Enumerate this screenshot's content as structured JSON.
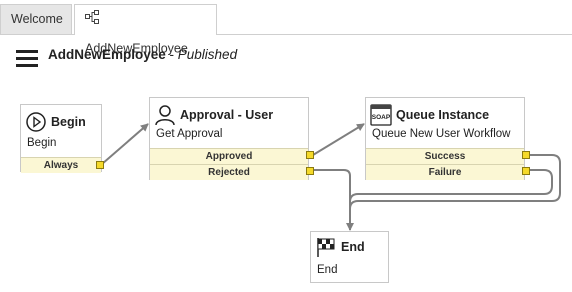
{
  "tabs": [
    {
      "label": "Welcome"
    },
    {
      "label": "AddNewEmployee"
    }
  ],
  "header": {
    "title": "AddNewEmployee",
    "separator": " - ",
    "status": "Published"
  },
  "nodes": {
    "begin": {
      "title": "Begin",
      "subtitle": "Begin",
      "ports": [
        "Always"
      ],
      "icon": "play-icon"
    },
    "approval": {
      "title": "Approval - User",
      "subtitle": "Get Approval",
      "ports": [
        "Approved",
        "Rejected"
      ],
      "icon": "user-icon"
    },
    "queue": {
      "title": "Queue Instance",
      "subtitle": "Queue New User Workflow",
      "ports": [
        "Success",
        "Failure"
      ],
      "icon": "soap-icon",
      "icon_text": "SOAP"
    },
    "end": {
      "title": "End",
      "subtitle": "End",
      "icon": "checkered-flag-icon"
    }
  },
  "colors": {
    "port": "#f5d92a",
    "port_row": "#fbf7d4",
    "connector": "#7f7f7f"
  }
}
